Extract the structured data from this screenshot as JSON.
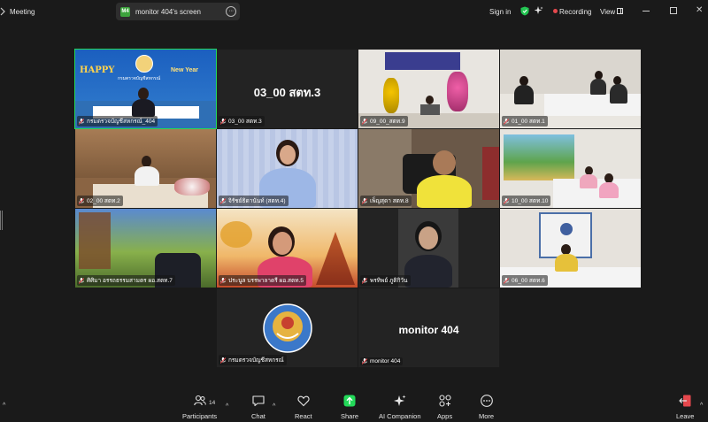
{
  "window": {
    "app_title": "Meeting",
    "share_indicator": "monitor 404's screen",
    "share_avatar": "M4",
    "sign_in": "Sign in",
    "recording": "Recording",
    "view": "View"
  },
  "tiles": {
    "t1": {
      "name": "กรมตรวจบัญชีสหกรณ์_404",
      "banner": "HAPPY",
      "banner2": "New Year",
      "org": "กรมตรวจบัญชีสหกรณ์"
    },
    "t2": {
      "name": "03_00 สตท.3",
      "display": "03_00 สตท.3"
    },
    "t3": {
      "name": "09_00_สตท.9"
    },
    "t4": {
      "name": "01_00 สตท.1"
    },
    "t5": {
      "name": "02_00 สตท.2"
    },
    "t6": {
      "name": "จิรัชย์ธิดานันท์ (สตท.4)"
    },
    "t7": {
      "name": "เพ็ญสุดา สตท.8"
    },
    "t8": {
      "name": "10_00 สตท.10"
    },
    "t9": {
      "name": "ศิศิมา อรรถธรรมสามตร ผอ.สตท.7"
    },
    "t10": {
      "name": "ประนูล บรรพาลาดรี ผอ.สตท.5"
    },
    "t11": {
      "name": "พรทิพย์ ภูติกิวัน"
    },
    "t12": {
      "name": "06_00 สตท.6"
    },
    "t13": {
      "name": "กรมตรวจบัญชีสหกรณ์"
    },
    "t14": {
      "name": "monitor 404",
      "display": "monitor 404"
    }
  },
  "toolbar": {
    "participants": "Participants",
    "participants_count": "14",
    "chat": "Chat",
    "react": "React",
    "share": "Share",
    "ai_companion": "AI Companion",
    "apps": "Apps",
    "more": "More",
    "leave": "Leave"
  },
  "colors": {
    "active_speaker": "#23d959",
    "share_green": "#23d959",
    "recording_red": "#e5484d",
    "leave_red": "#e5484d"
  },
  "icons": [
    "shield-icon",
    "sparkle-icon",
    "mic-off-icon",
    "participants-icon",
    "chat-icon",
    "react-icon",
    "share-icon",
    "ai-companion-icon",
    "apps-icon",
    "more-icon",
    "leave-icon"
  ]
}
